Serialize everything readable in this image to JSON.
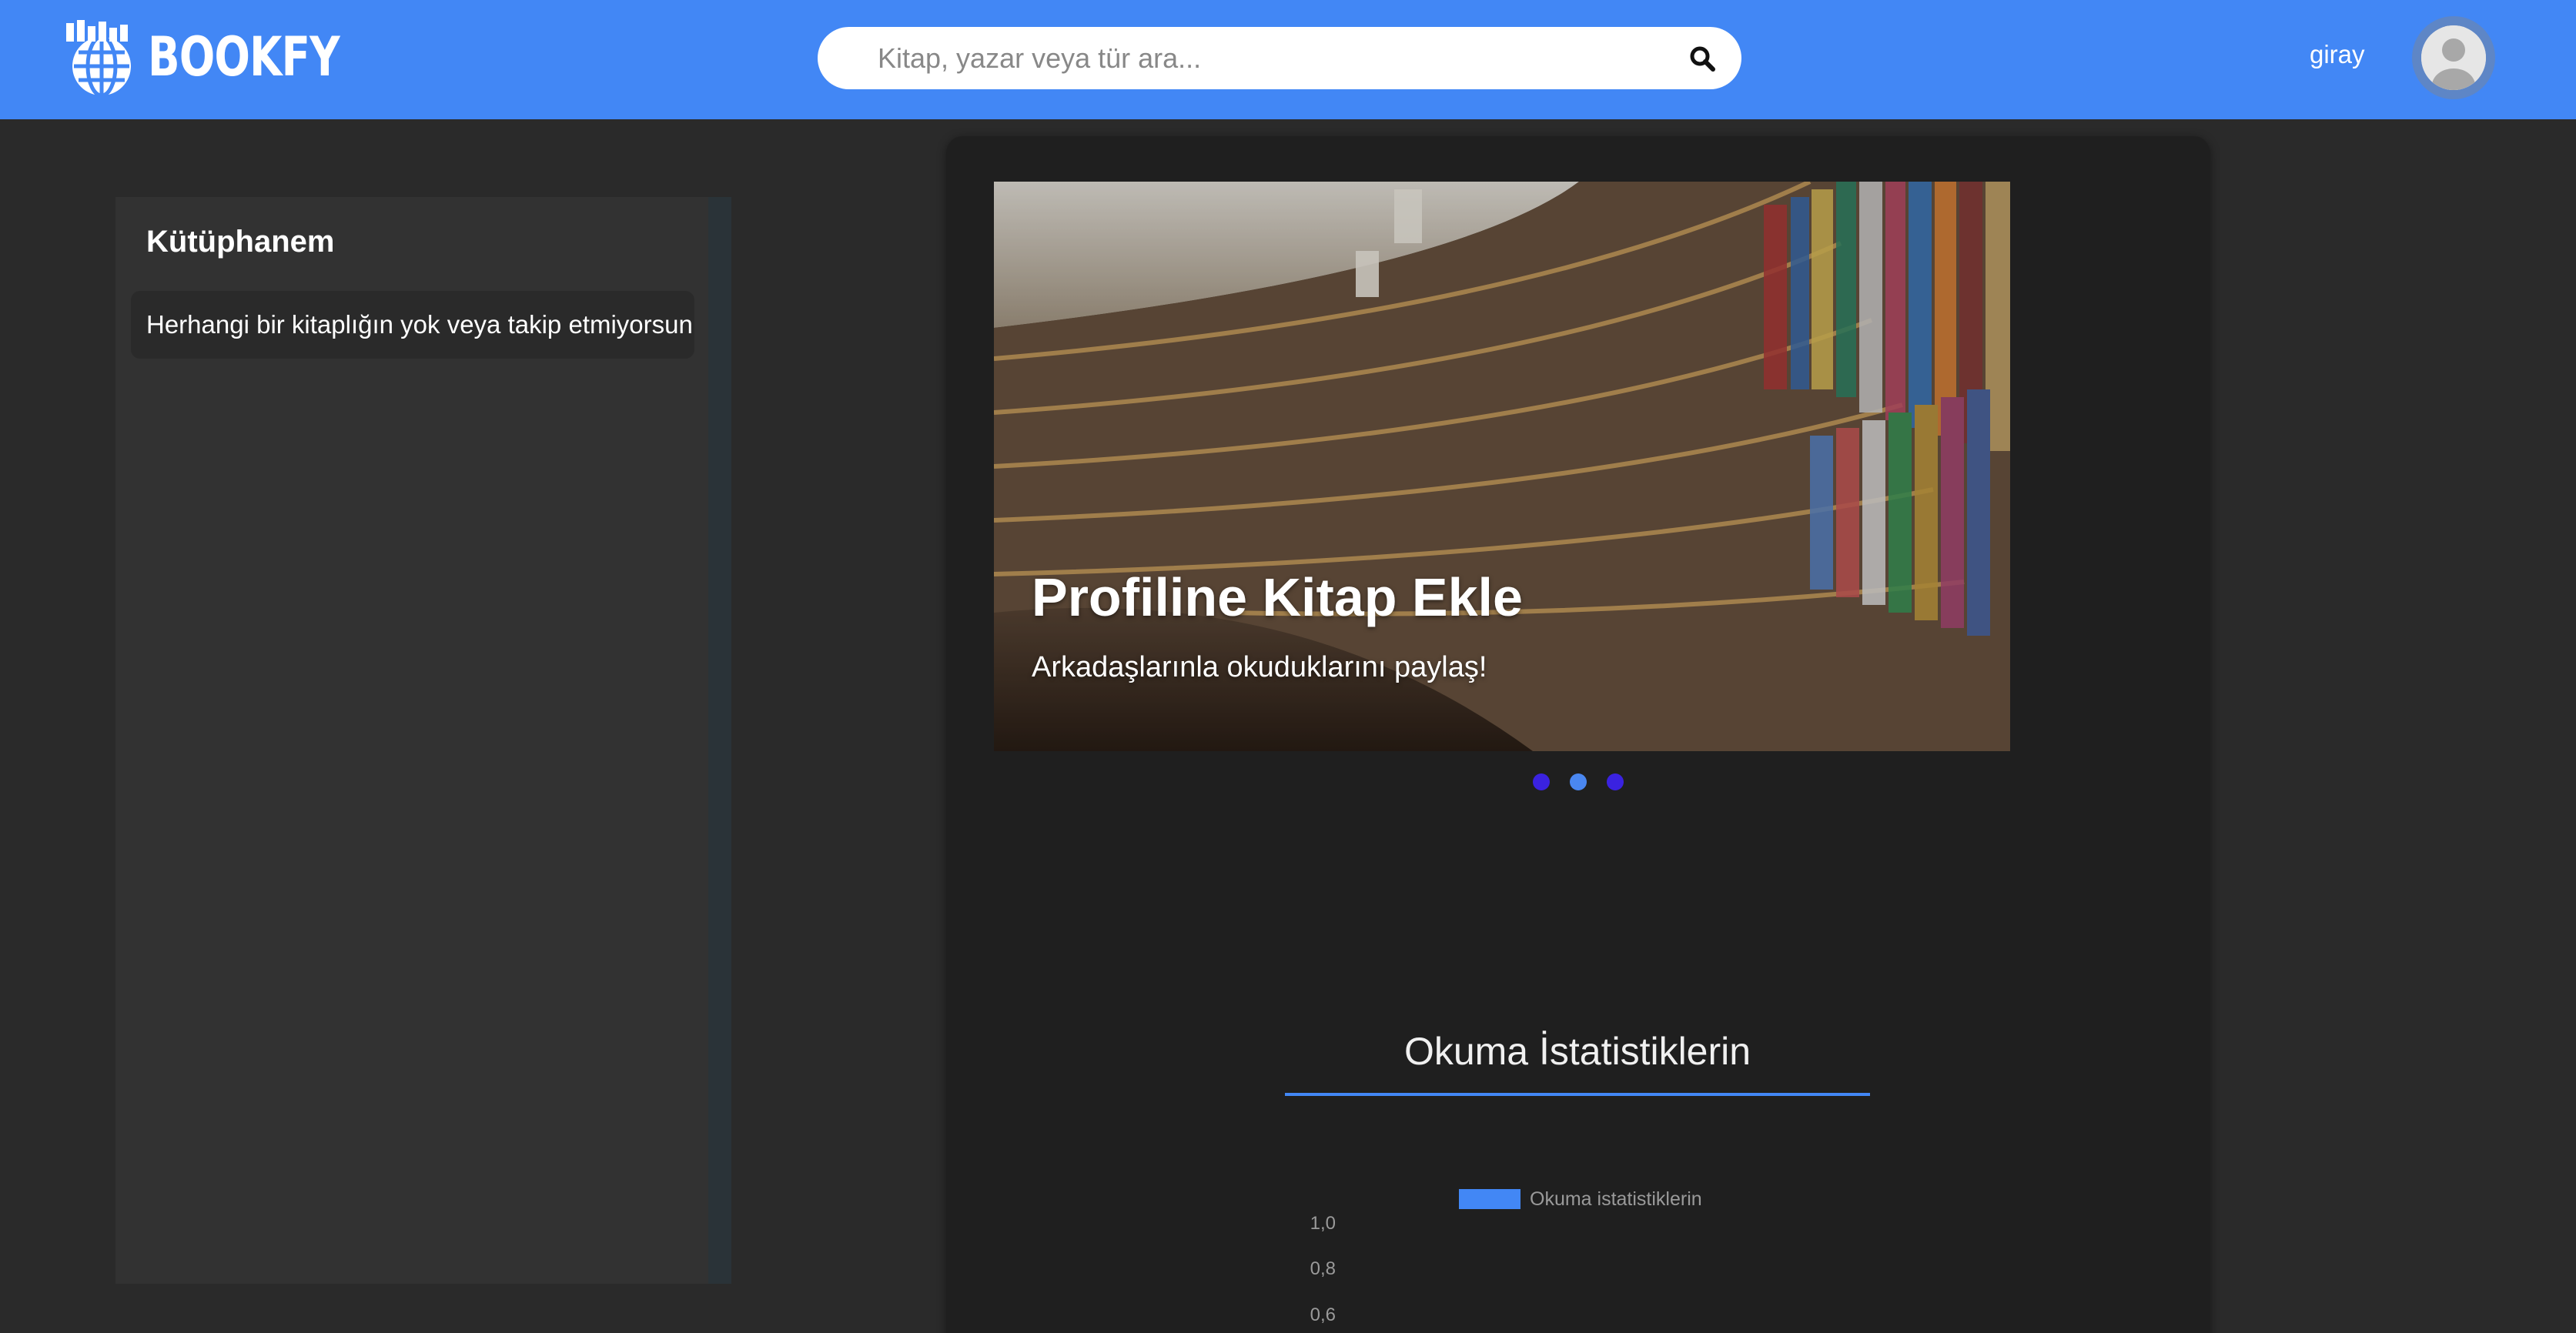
{
  "header": {
    "brand": "BOOKFY",
    "search_placeholder": "Kitap, yazar veya tür ara...",
    "search_icon": "search-icon",
    "username": "giray",
    "avatar_icon": "user-avatar-icon"
  },
  "sidebar": {
    "title": "Kütüphanem",
    "empty_message": "Herhangi bir kitaplığın yok veya takip etmiyorsun"
  },
  "carousel": {
    "title": "Profiline Kitap Ekle",
    "subtitle": "Arkadaşlarınla okuduklarını paylaş!",
    "slide_count": 3,
    "active_index": 1
  },
  "stats": {
    "title": "Okuma İstatistiklerin"
  },
  "chart_data": {
    "type": "bar",
    "series": [
      {
        "name": "Okuma istatistiklerin",
        "values": []
      }
    ],
    "categories": [],
    "y_ticks": [
      "1,0",
      "0,8",
      "0,6"
    ],
    "ylim": [
      0,
      1
    ]
  },
  "colors": {
    "accent": "#4287f5",
    "background": "#2a2a2a",
    "panel": "#1f1f1f",
    "dot_inactive": "#3a22e0",
    "dot_active": "#4a87f0"
  }
}
